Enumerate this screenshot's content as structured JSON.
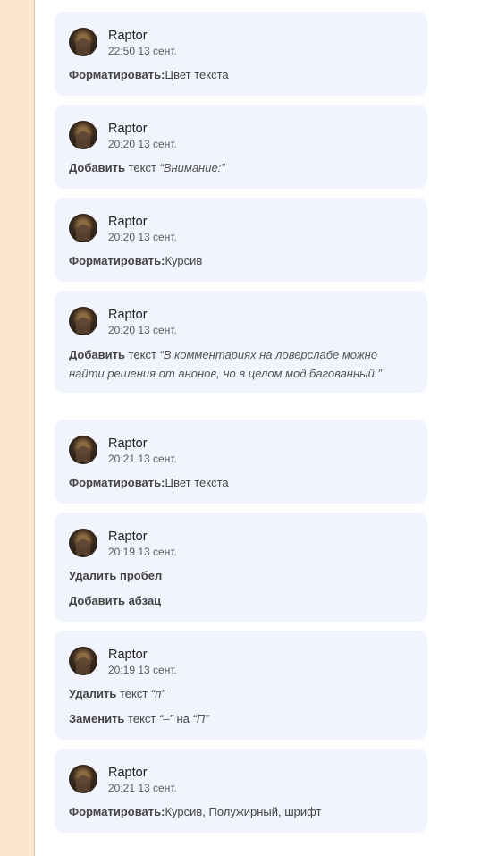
{
  "cards": [
    {
      "author": "Raptor",
      "time": "22:50 13 сент.",
      "lines": [
        {
          "verb": "Форматировать:",
          "rest": "Цвет текста"
        }
      ]
    },
    {
      "author": "Raptor",
      "time": "20:20 13 сент.",
      "lines": [
        {
          "verb": "Добавить",
          "text_word": " текст ",
          "quote": "“Внимание:”"
        }
      ]
    },
    {
      "author": "Raptor",
      "time": "20:20 13 сент.",
      "lines": [
        {
          "verb": "Форматировать:",
          "rest": "Курсив"
        }
      ]
    },
    {
      "author": "Raptor",
      "time": "20:20 13 сент.",
      "lines": [
        {
          "verb": "Добавить",
          "text_word": " текст ",
          "quote": "“В комментариях на ловерслабе можно найти решения от анонов, но в целом мод багованный.”"
        }
      ]
    },
    {
      "author": "Raptor",
      "time": "20:21 13 сент.",
      "lines": [
        {
          "verb": "Форматировать:",
          "rest": "Цвет текста"
        }
      ]
    },
    {
      "author": "Raptor",
      "time": "20:19 13 сент.",
      "lines": [
        {
          "verb": "Удалить пробел"
        },
        {
          "verb": "Добавить абзац"
        }
      ]
    },
    {
      "author": "Raptor",
      "time": "20:19 13 сент.",
      "lines": [
        {
          "verb": "Удалить",
          "text_word": " текст ",
          "quote": "“п”"
        },
        {
          "verb": "Заменить",
          "text_word": " текст ",
          "quote": "“–”",
          "mid": " на ",
          "quote2": "“П”"
        }
      ]
    },
    {
      "author": "Raptor",
      "time": "20:21 13 сент.",
      "lines": [
        {
          "verb": "Форматировать:",
          "rest": "Курсив, Полужирный, шрифт"
        }
      ]
    }
  ]
}
